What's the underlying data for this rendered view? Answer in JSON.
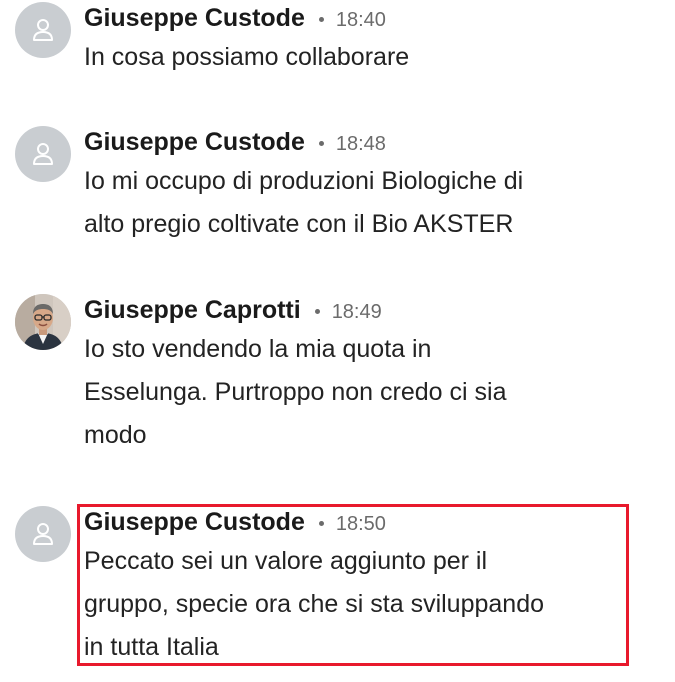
{
  "messages": [
    {
      "sender": "Giuseppe Custode",
      "time": "18:40",
      "avatar": "person-placeholder-icon",
      "lines": [
        "In cosa possiamo collaborare"
      ]
    },
    {
      "sender": "Giuseppe Custode",
      "time": "18:48",
      "avatar": "person-placeholder-icon",
      "lines": [
        "Io mi occupo di produzioni Biologiche di",
        "alto pregio coltivate con il Bio AKSTER"
      ]
    },
    {
      "sender": "Giuseppe Caprotti",
      "time": "18:49",
      "avatar": "profile-photo",
      "lines": [
        "Io sto vendendo la mia quota in",
        "Esselunga. Purtroppo non credo ci sia",
        "modo"
      ]
    },
    {
      "sender": "Giuseppe Custode",
      "time": "18:50",
      "avatar": "person-placeholder-icon",
      "lines": [
        "Peccato sei un valore aggiunto per il",
        "gruppo, specie ora che si sta sviluppando",
        "in tutta Italia"
      ]
    }
  ],
  "colors": {
    "highlight_border": "#e8192c",
    "placeholder_avatar": "#c9cdd1",
    "meta_text": "#6b6b6b"
  }
}
